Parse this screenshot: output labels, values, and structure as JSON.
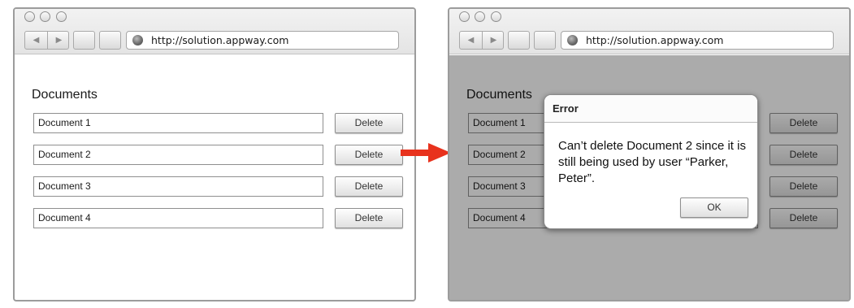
{
  "browser": {
    "url": "http://solution.appway.com",
    "back_glyph": "◀",
    "forward_glyph": "▶"
  },
  "page": {
    "heading": "Documents",
    "documents": [
      {
        "name": "Document 1",
        "action": "Delete"
      },
      {
        "name": "Document 2",
        "action": "Delete"
      },
      {
        "name": "Document 3",
        "action": "Delete"
      },
      {
        "name": "Document 4",
        "action": "Delete"
      }
    ]
  },
  "error_dialog": {
    "title": "Error",
    "message": "Can’t delete Document 2 since it is still being used by user “Parker, Peter”.",
    "ok_label": "OK"
  },
  "colors": {
    "arrow": "#e8321d",
    "overlay": "#a8a8a8"
  },
  "icons": [
    "globe-icon",
    "back-arrow-icon",
    "forward-arrow-icon",
    "arrow-right-icon"
  ]
}
